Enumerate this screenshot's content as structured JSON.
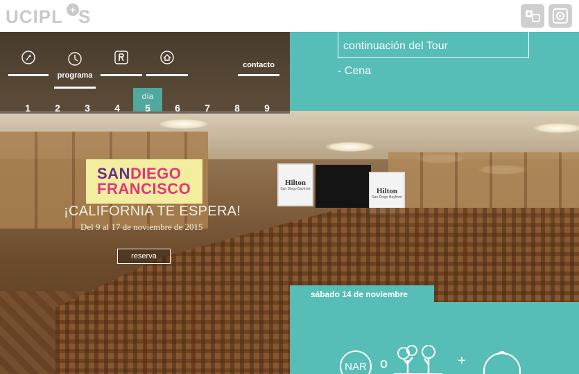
{
  "header": {
    "brand": "UCIPL",
    "brand_tail": "S",
    "icons": [
      "user-card-icon",
      "settings-icon"
    ]
  },
  "nav": {
    "items": [
      {
        "label": "",
        "icon": "fork-icon"
      },
      {
        "label": "programa",
        "icon": "clock-icon"
      },
      {
        "label": "",
        "icon": "restaurant-icon"
      },
      {
        "label": "",
        "icon": "hotel-icon"
      },
      {
        "label": "contacto",
        "icon": ""
      }
    ],
    "day_caption": "día",
    "days": [
      "1",
      "2",
      "3",
      "4",
      "5",
      "6",
      "7",
      "8",
      "9"
    ],
    "selected_day": "5"
  },
  "itinerary": {
    "tour_text": "continuación del Tour",
    "cena_text": "- Cena",
    "date_label": "sábado 14 de noviembre",
    "nar_label": "NAR",
    "op_o": "o",
    "op_plus": "+"
  },
  "hero": {
    "logo_line1_a": "SAN",
    "logo_line1_b": "DIEGO",
    "logo_line2": "FRANCISCO",
    "tagline": "¡CALIFORNIA TE ESPERA!",
    "dates": "Del 9 al 17 de noviembre de 2015",
    "reserve_button": "reserva",
    "banner_logo": "Hilton",
    "banner_sub": "San Diego Bayfront"
  },
  "colors": {
    "teal": "#56bdb7",
    "sd_purple": "#6b2b8a",
    "sd_pink": "#e0367a",
    "logo_bg": "#f3eda0"
  }
}
